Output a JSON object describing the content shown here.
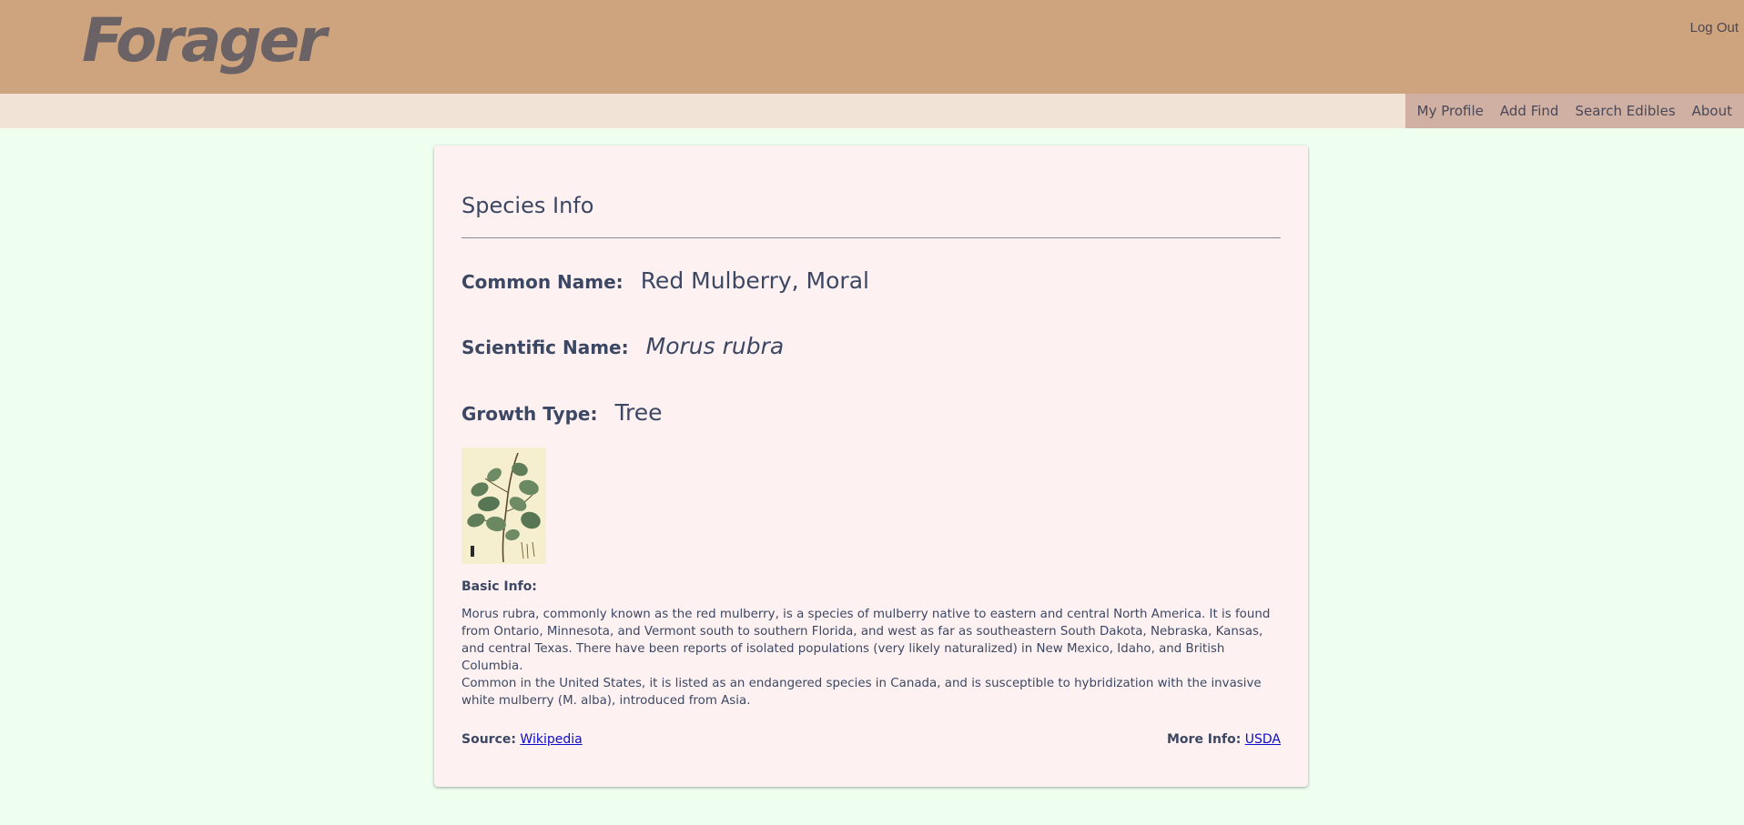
{
  "header": {
    "logo": "Forager",
    "logout_label": "Log Out"
  },
  "nav": {
    "items": [
      {
        "label": "My Profile"
      },
      {
        "label": "Add Find"
      },
      {
        "label": "Search Edibles"
      },
      {
        "label": "About"
      }
    ]
  },
  "species": {
    "heading": "Species Info",
    "common_label": "Common Name:",
    "common_value": "Red Mulberry, Moral",
    "scientific_label": "Scientific Name:",
    "scientific_value": "Morus rubra",
    "growth_label": "Growth Type:",
    "growth_value": "Tree",
    "basic_label": "Basic Info:",
    "paragraph1": "Morus rubra, commonly known as the red mulberry, is a species of mulberry native to eastern and central North America. It is found from Ontario, Minnesota, and Vermont south to southern Florida, and west as far as southeastern South Dakota, Nebraska, Kansas, and central Texas. There have been reports of isolated populations (very likely naturalized) in New Mexico, Idaho, and British Columbia.",
    "paragraph2": "Common in the United States, it is listed as an endangered species in Canada, and is susceptible to hybridization with the invasive white mulberry (M. alba), introduced from Asia.",
    "source_label": "Source:",
    "source_link": "Wikipedia",
    "more_label": "More Info:",
    "more_link": "USDA",
    "image_icon": "plant-illustration"
  },
  "colors": {
    "header_bg": "#cda47e",
    "nav_bg": "#f1e4d6",
    "nav_links_bg": "#cfb0a3",
    "page_bg": "#eefff0",
    "card_bg": "#fdf2f1",
    "text": "#3c4764",
    "link": "#0c0ccc"
  }
}
